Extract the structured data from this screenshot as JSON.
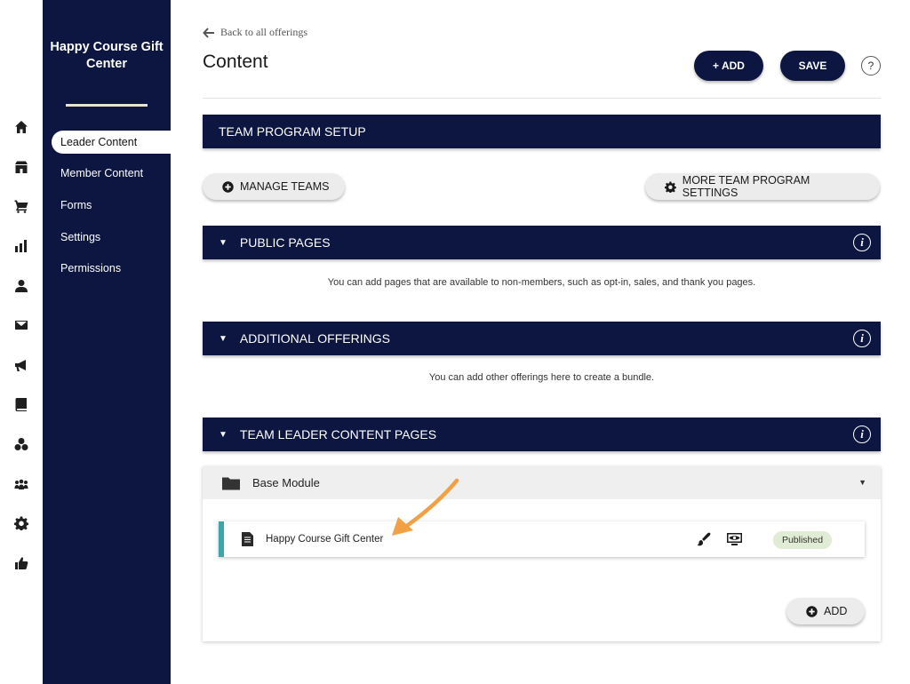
{
  "sidebar": {
    "brand": "Happy Course Gift Center",
    "items": [
      {
        "label": "Leader Content",
        "active": true
      },
      {
        "label": "Member Content"
      },
      {
        "label": "Forms"
      },
      {
        "label": "Settings"
      },
      {
        "label": "Permissions"
      }
    ]
  },
  "rail": [
    "home-icon",
    "store-icon",
    "cart-icon",
    "chart-icon",
    "user-icon",
    "mail-icon",
    "megaphone-icon",
    "book-icon",
    "groups-icon",
    "community-icon",
    "gear-icon",
    "thumbs-up-icon"
  ],
  "header": {
    "back_link": "Back to all offerings",
    "title": "Content",
    "add_label": "+ ADD",
    "save_label": "SAVE",
    "help_label": "?"
  },
  "team_setup": {
    "title": "TEAM PROGRAM SETUP",
    "manage_label": "MANAGE TEAMS",
    "settings_label": "MORE TEAM PROGRAM SETTINGS"
  },
  "public_pages": {
    "title": "PUBLIC PAGES",
    "note": "You can add pages that are available to non-members, such as opt-in, sales, and thank you pages."
  },
  "additional_offerings": {
    "title": "ADDITIONAL OFFERINGS",
    "note": "You can add other offerings here to create a bundle."
  },
  "leader_pages": {
    "title": "TEAM LEADER CONTENT PAGES",
    "module_name": "Base Module",
    "page_name": "Happy Course Gift Center",
    "status": "Published",
    "add_label": "ADD"
  },
  "colors": {
    "navy": "#0c1640",
    "teal": "#3aa6a6",
    "badge_bg": "#e1ecd4",
    "annotation": "#f2a043"
  }
}
